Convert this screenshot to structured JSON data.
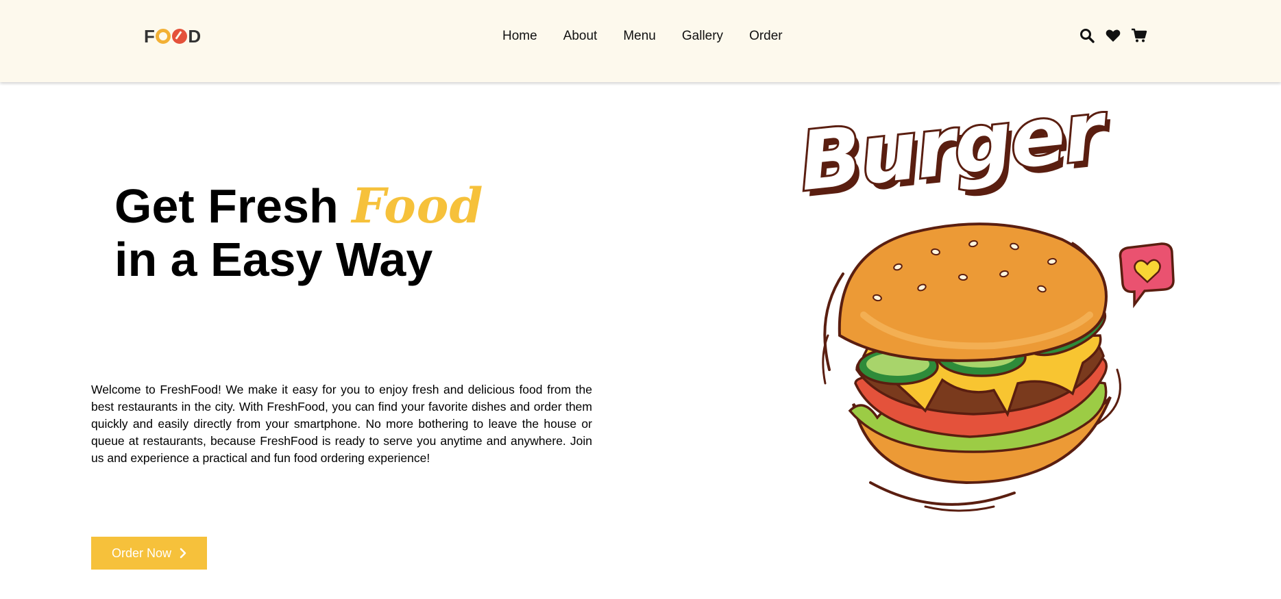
{
  "brand": {
    "logo_text": "FOOD"
  },
  "nav": {
    "items": [
      "Home",
      "About",
      "Menu",
      "Gallery",
      "Order"
    ]
  },
  "header_icons": [
    "search-icon",
    "heart-icon",
    "cart-icon"
  ],
  "hero": {
    "title_part1": "Get Fresh ",
    "title_accent": "Food",
    "title_line2": "in a Easy Way",
    "description": "Welcome to FreshFood! We make it easy for you to enjoy fresh and delicious food from the best restaurants in the city. With FreshFood, you can find your favorite dishes and order them quickly and easily directly from your smartphone. No more bothering to leave the house or queue at restaurants, because FreshFood is ready to serve you anytime and anywhere. Join us and experience a practical and fun food ordering experience!",
    "cta_label": "Order Now"
  },
  "illustration": {
    "word": "Burger"
  },
  "colors": {
    "header_bg": "#fdf9ed",
    "accent": "#f6c13b",
    "text": "#000000"
  }
}
